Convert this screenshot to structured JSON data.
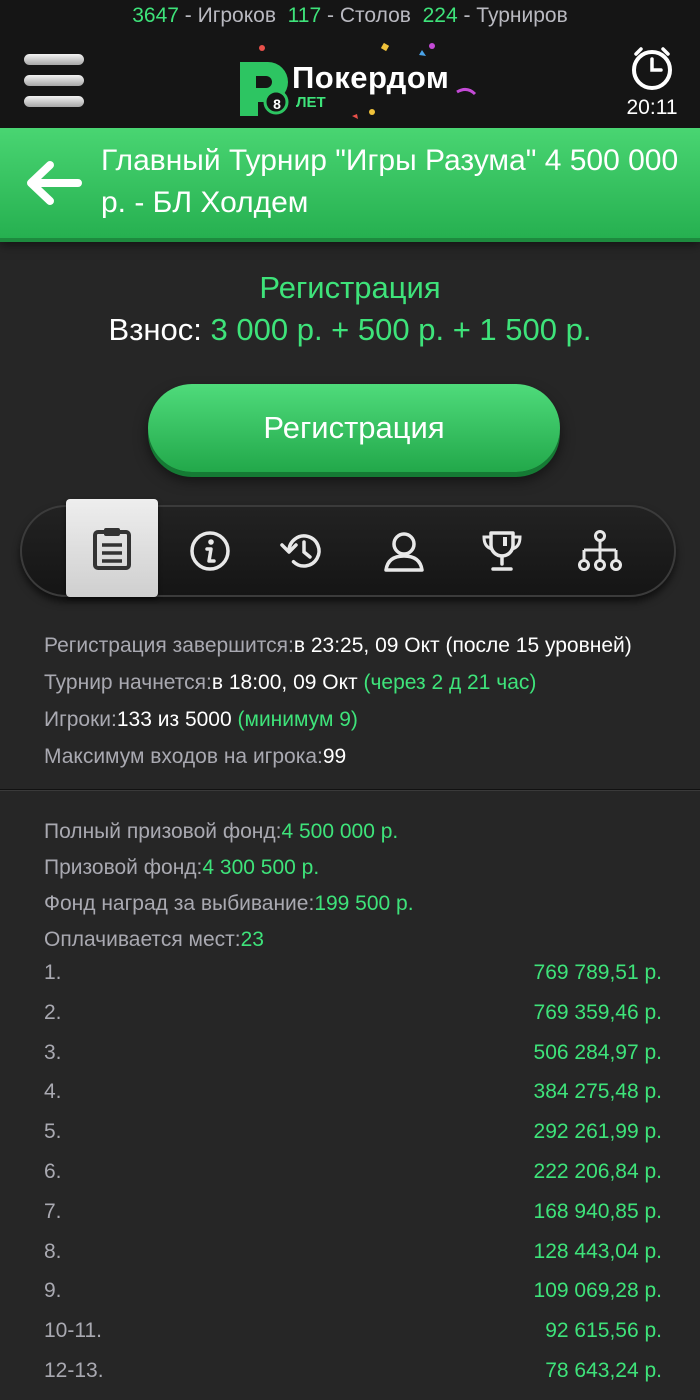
{
  "stats": {
    "players_count": "3647",
    "players_label": "- Игроков",
    "tables_count": "117",
    "tables_label": "- Столов",
    "tournaments_count": "224",
    "tournaments_label": "- Турниров"
  },
  "header": {
    "logo_text": "Покердом",
    "logo_badge": "8",
    "logo_years": "ЛЕТ",
    "clock_time": "20:11"
  },
  "title": {
    "text": "Главный Турнир \"Игры Разума\" 4 500 000 р. - БЛ Холдем"
  },
  "registration": {
    "status": "Регистрация",
    "buyin_label": "Взнос:",
    "buyin_value": "3 000 р. + 500 р. + 1 500 р.",
    "button_label": "Регистрация"
  },
  "tabs": [
    {
      "icon": "clipboard-icon",
      "active": true
    },
    {
      "icon": "info-icon",
      "active": false
    },
    {
      "icon": "history-icon",
      "active": false
    },
    {
      "icon": "player-icon",
      "active": false
    },
    {
      "icon": "trophy-icon",
      "active": false
    },
    {
      "icon": "bracket-icon",
      "active": false
    }
  ],
  "info": {
    "reg_ends_label": "Регистрация завершится:",
    "reg_ends_value": "в 23:25, 09 Окт (после 15 уровней)",
    "start_label": "Турнир начнется:",
    "start_value": "в 18:00, 09 Окт",
    "start_countdown": "(через 2 д 21 час)",
    "players_label": "Игроки:",
    "players_value": "133 из 5000",
    "players_min": "(минимум 9)",
    "max_entries_label": "Максимум входов на игрока:",
    "max_entries_value": "99"
  },
  "prize": {
    "full_pool_label": "Полный призовой фонд:",
    "full_pool_value": "4 500 000 р.",
    "pool_label": "Призовой фонд:",
    "pool_value": "4 300 500 р.",
    "bounty_label": "Фонд наград за выбивание:",
    "bounty_value": "199 500 р.",
    "paid_label": "Оплачивается мест:",
    "paid_value": "23"
  },
  "places": [
    {
      "pos": "1.",
      "amount": "769 789,51 р."
    },
    {
      "pos": "2.",
      "amount": "769 359,46 р."
    },
    {
      "pos": "3.",
      "amount": "506 284,97 р."
    },
    {
      "pos": "4.",
      "amount": "384 275,48 р."
    },
    {
      "pos": "5.",
      "amount": "292 261,99 р."
    },
    {
      "pos": "6.",
      "amount": "222 206,84 р."
    },
    {
      "pos": "7.",
      "amount": "168 940,85 р."
    },
    {
      "pos": "8.",
      "amount": "128 443,04 р."
    },
    {
      "pos": "9.",
      "amount": "109 069,28 р."
    },
    {
      "pos": "10-11.",
      "amount": "92 615,56 р."
    },
    {
      "pos": "12-13.",
      "amount": "78 643,24 р."
    }
  ],
  "colors": {
    "accent": "#3ee37a",
    "background": "#262626",
    "header": "#151515",
    "muted_text": "#a9a9b1"
  }
}
